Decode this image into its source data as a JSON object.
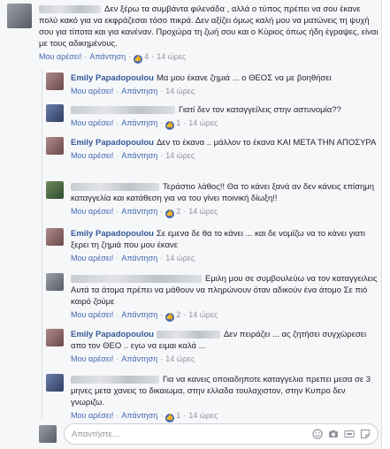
{
  "actions": {
    "like": "Μου αρέσει!",
    "reply": "Απάντηση",
    "separator": "·"
  },
  "top_comment": {
    "text": "Δεν ξέρω τα συμβάντα φιλενάδα , αλλά ο τύπος πρέπει να σου έκανε πολύ κακό για να εκφράζεσαι τόσο πικρά. Δεν αξίζει όμως καλή μου να ματώνεις τη ψυχή σου για τίποτα και για κανέναν. Προχώρα τη ζωή σου και ο Κύριος όπως ήδη έγραψες, είναι με τους αδικημένους.",
    "likes": "4",
    "time": "14 ώρες"
  },
  "replies": [
    {
      "name": "Emily Papadopoulou",
      "text": "Μα μου έκανε ζημιά ... ο ΘΕΟΣ να με βοηθήσει",
      "likes": "",
      "time": "14 ώρες"
    },
    {
      "name": "",
      "text": "Γιατί δεν τον καταγγείλεις στην αστυνομία??",
      "likes": "1",
      "time": "14 ώρες"
    },
    {
      "name": "Emily Papadopoulou",
      "text": "Δεν το έκανα .. μάλλον το έκανα ΚΑΙ ΜΕΤΑ ΤΗΝ ΑΠΟΣΥΡΑ",
      "likes": "",
      "time": "14 ώρες"
    },
    {
      "name": "",
      "text": "Τεράστιο λάθος!! Θα το κάνει ξανά αν δεν κάνεις επίσημη καταγγελία και κατάθεση για να του γίνει ποινική δίωξη!!",
      "likes": "2",
      "time": "14 ώρες"
    },
    {
      "name": "Emily Papadopoulou",
      "text": "Σε εμενα δε θα το κάνει ... και δε νομίζω να το κάνει γιατι ξερει τη ζημιά που μου έκανε",
      "likes": "",
      "time": "14 ώρες"
    },
    {
      "name": "",
      "text": "Εμιλη μου σε συμβουλεύω να τον καταγγειλεις Αυτά τα άτομα πρέπει να μάθουν να πληρώνουν όταν αδικούν ένα άτομο Σε πιό καιρό ζούμε",
      "likes": "2",
      "time": "14 ώρες"
    },
    {
      "name": "Emily Papadopoulou",
      "text": "Δεν πειράζει ... ας ζητήσει συγχώρεσει απο τον ΘΕΟ .. εγω να ειμαι καλά ...",
      "likes": "",
      "time": "14 ώρες"
    },
    {
      "name": "",
      "text": "Για να κανεις οποιαδηποτε καταγγελια πρεπει μεσα σε 3 μηνες μετα χανεις το δικαιωμα, στην ελλαδα τουλαχιστον, στην Κυπρο δεν γνωριζω.",
      "likes": "1",
      "time": "14 ώρες"
    }
  ],
  "composer": {
    "placeholder": "Απαντήστε..."
  }
}
